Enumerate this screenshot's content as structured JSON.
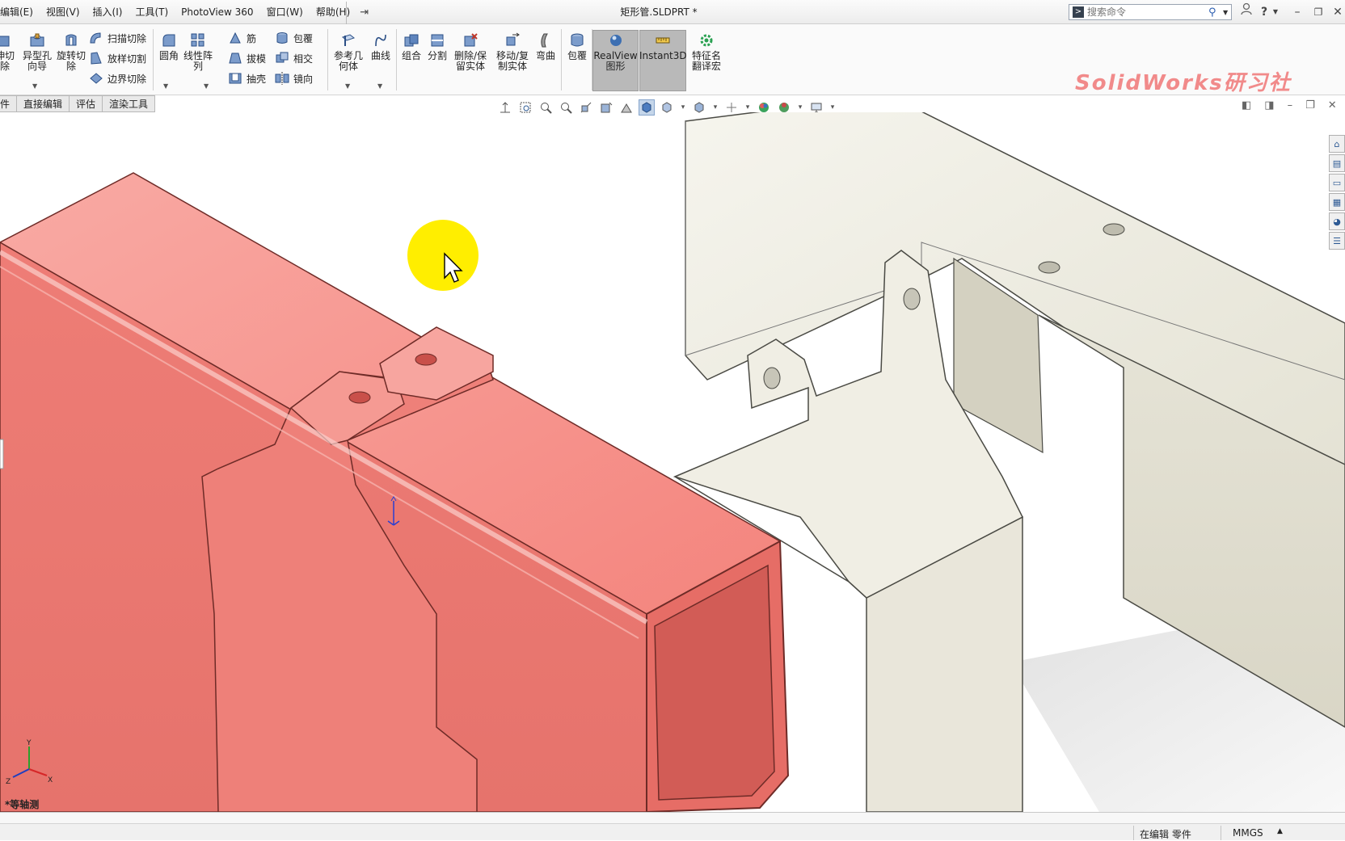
{
  "menu": {
    "items": [
      "编辑(E)",
      "视图(V)",
      "插入(I)",
      "工具(T)",
      "PhotoView 360",
      "窗口(W)",
      "帮助(H)"
    ]
  },
  "window": {
    "title": "矩形管.SLDPRT *"
  },
  "search": {
    "placeholder": "搜索命令"
  },
  "ribbon": {
    "cut_extrude_partial": "伸切\n除",
    "hole_wizard": "异型孔\n向导",
    "revolved_cut": "旋转切\n除",
    "swept_cut": "扫描切除",
    "lofted_cut": "放样切割",
    "boundary_cut": "边界切除",
    "fillet": "圆角",
    "linear_pattern": "线性阵\n列",
    "rib": "筋",
    "draft": "拔模",
    "shell": "抽壳",
    "wrap": "包覆",
    "intersect": "相交",
    "mirror": "镜向",
    "reference_geometry": "参考几\n何体",
    "curves": "曲线",
    "combine": "组合",
    "split": "分割",
    "delete_keep_body": "删除/保\n留实体",
    "move_copy_body": "移动/复\n制实体",
    "flex": "弯曲",
    "wrap2": "包覆",
    "realview": "RealView\n图形",
    "instant3d": "Instant3D",
    "feature_translate": "特征名\n翻译宏"
  },
  "watermark": "SolidWorks研习社",
  "tabs": [
    "件",
    "直接编辑",
    "评估",
    "渲染工具"
  ],
  "viewport": {
    "view_name": "*等轴测"
  },
  "statusbar": {
    "editing": "在编辑 零件",
    "units": "MMGS",
    "units_arrow": "▲"
  },
  "colors": {
    "red_body": "#f07f79",
    "metal_body": "#e8e6da",
    "cursor_highlight": "#ffee00",
    "watermark": "#f18a8a"
  }
}
